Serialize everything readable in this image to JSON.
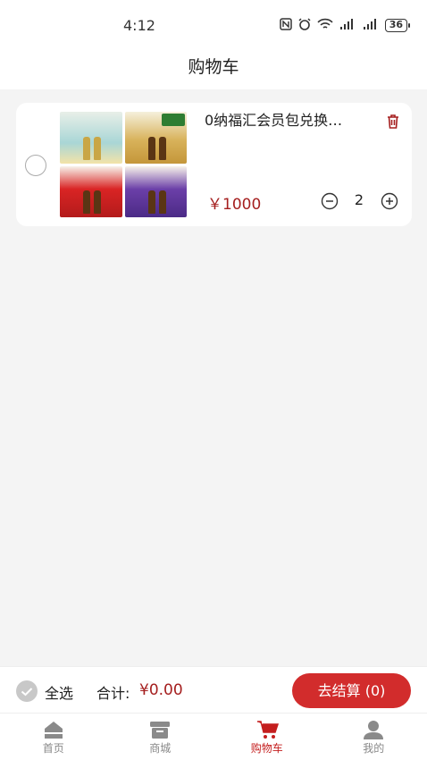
{
  "status_bar": {
    "time": "4:12",
    "battery": "36"
  },
  "header": {
    "title": "购物车"
  },
  "cart": {
    "items": [
      {
        "name": "0纳福汇会员包兑换…",
        "price": "￥1000",
        "quantity": "2",
        "selected": false,
        "icons": [
          "trash-icon",
          "minus-circle-icon",
          "plus-circle-icon"
        ]
      }
    ]
  },
  "footer": {
    "select_all_label": "全选",
    "total_label": "合计:",
    "total_value": "¥0.00",
    "checkout_label": "去结算 (0)"
  },
  "tabs": [
    {
      "label": "首页",
      "icon": "home-icon",
      "active": false
    },
    {
      "label": "商城",
      "icon": "store-icon",
      "active": false
    },
    {
      "label": "购物车",
      "icon": "cart-icon",
      "active": true
    },
    {
      "label": "我的",
      "icon": "user-icon",
      "active": false
    }
  ],
  "colors": {
    "accent": "#c41e1e",
    "price": "#a51f1f",
    "background": "#f4f4f4"
  }
}
